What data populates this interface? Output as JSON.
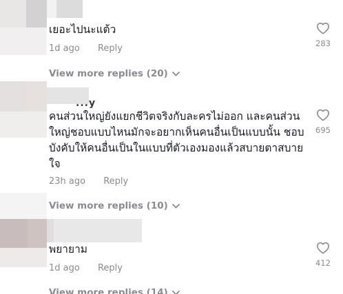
{
  "comments": [
    {
      "text": "เยอะไปนะแต้ว",
      "time": "1d ago",
      "reply_label": "Reply",
      "likes": "283",
      "view_more": "View more replies (20)"
    },
    {
      "author_fragment": "...y",
      "text_lines": [
        "คนส่วนใหญ่ยังแยกชีวิตจริงกับละครไม่ออก และคนส่วน",
        "ใหญ่ชอบแบบไหนมักจะอยากเห็นคนอื่นเป็นแบบนั้น ชอบ",
        "บังคับให้คนอื่นเป็นในแบบที่ตัวเองมองแล้วสบายตาสบาย",
        "ใจ"
      ],
      "time": "23h ago",
      "reply_label": "Reply",
      "likes": "695",
      "view_more": "View more replies (10)"
    },
    {
      "text": "พยายาม",
      "time": "1d ago",
      "reply_label": "Reply",
      "likes": "412",
      "view_more": "View more replies (14)"
    }
  ],
  "icons": {
    "like": "heart-outline-icon",
    "expand": "chevron-down-icon"
  },
  "colors": {
    "text": "#161823",
    "secondary": "#8a8b91",
    "background": "#ffffff"
  }
}
